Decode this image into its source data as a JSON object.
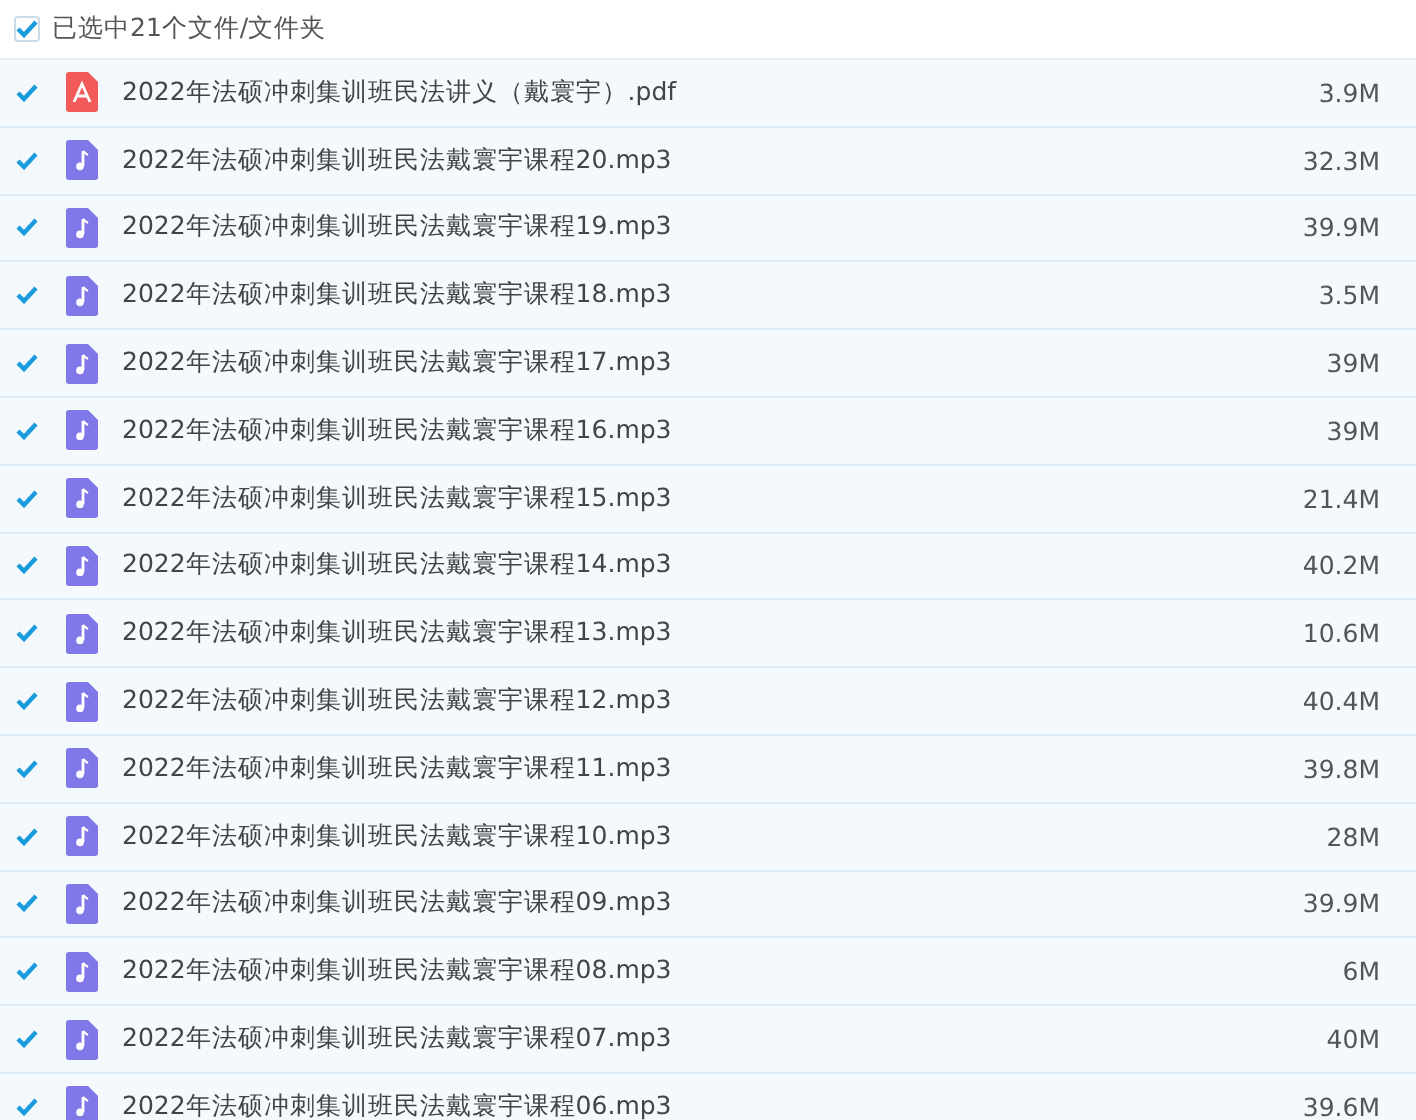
{
  "header": {
    "label": "已选中21个文件/文件夹",
    "checked": true
  },
  "files": [
    {
      "kind": "pdf",
      "name": "2022年法硕冲刺集训班民法讲义（戴寰宇）.pdf",
      "size": "3.9M",
      "checked": true
    },
    {
      "kind": "audio",
      "name": "2022年法硕冲刺集训班民法戴寰宇课程20.mp3",
      "size": "32.3M",
      "checked": true
    },
    {
      "kind": "audio",
      "name": "2022年法硕冲刺集训班民法戴寰宇课程19.mp3",
      "size": "39.9M",
      "checked": true
    },
    {
      "kind": "audio",
      "name": "2022年法硕冲刺集训班民法戴寰宇课程18.mp3",
      "size": "3.5M",
      "checked": true
    },
    {
      "kind": "audio",
      "name": "2022年法硕冲刺集训班民法戴寰宇课程17.mp3",
      "size": "39M",
      "checked": true
    },
    {
      "kind": "audio",
      "name": "2022年法硕冲刺集训班民法戴寰宇课程16.mp3",
      "size": "39M",
      "checked": true
    },
    {
      "kind": "audio",
      "name": "2022年法硕冲刺集训班民法戴寰宇课程15.mp3",
      "size": "21.4M",
      "checked": true
    },
    {
      "kind": "audio",
      "name": "2022年法硕冲刺集训班民法戴寰宇课程14.mp3",
      "size": "40.2M",
      "checked": true
    },
    {
      "kind": "audio",
      "name": "2022年法硕冲刺集训班民法戴寰宇课程13.mp3",
      "size": "10.6M",
      "checked": true
    },
    {
      "kind": "audio",
      "name": "2022年法硕冲刺集训班民法戴寰宇课程12.mp3",
      "size": "40.4M",
      "checked": true
    },
    {
      "kind": "audio",
      "name": "2022年法硕冲刺集训班民法戴寰宇课程11.mp3",
      "size": "39.8M",
      "checked": true
    },
    {
      "kind": "audio",
      "name": "2022年法硕冲刺集训班民法戴寰宇课程10.mp3",
      "size": "28M",
      "checked": true
    },
    {
      "kind": "audio",
      "name": "2022年法硕冲刺集训班民法戴寰宇课程09.mp3",
      "size": "39.9M",
      "checked": true
    },
    {
      "kind": "audio",
      "name": "2022年法硕冲刺集训班民法戴寰宇课程08.mp3",
      "size": "6M",
      "checked": true
    },
    {
      "kind": "audio",
      "name": "2022年法硕冲刺集训班民法戴寰宇课程07.mp3",
      "size": "40M",
      "checked": true
    },
    {
      "kind": "audio",
      "name": "2022年法硕冲刺集训班民法戴寰宇课程06.mp3",
      "size": "39.6M",
      "checked": true
    }
  ]
}
